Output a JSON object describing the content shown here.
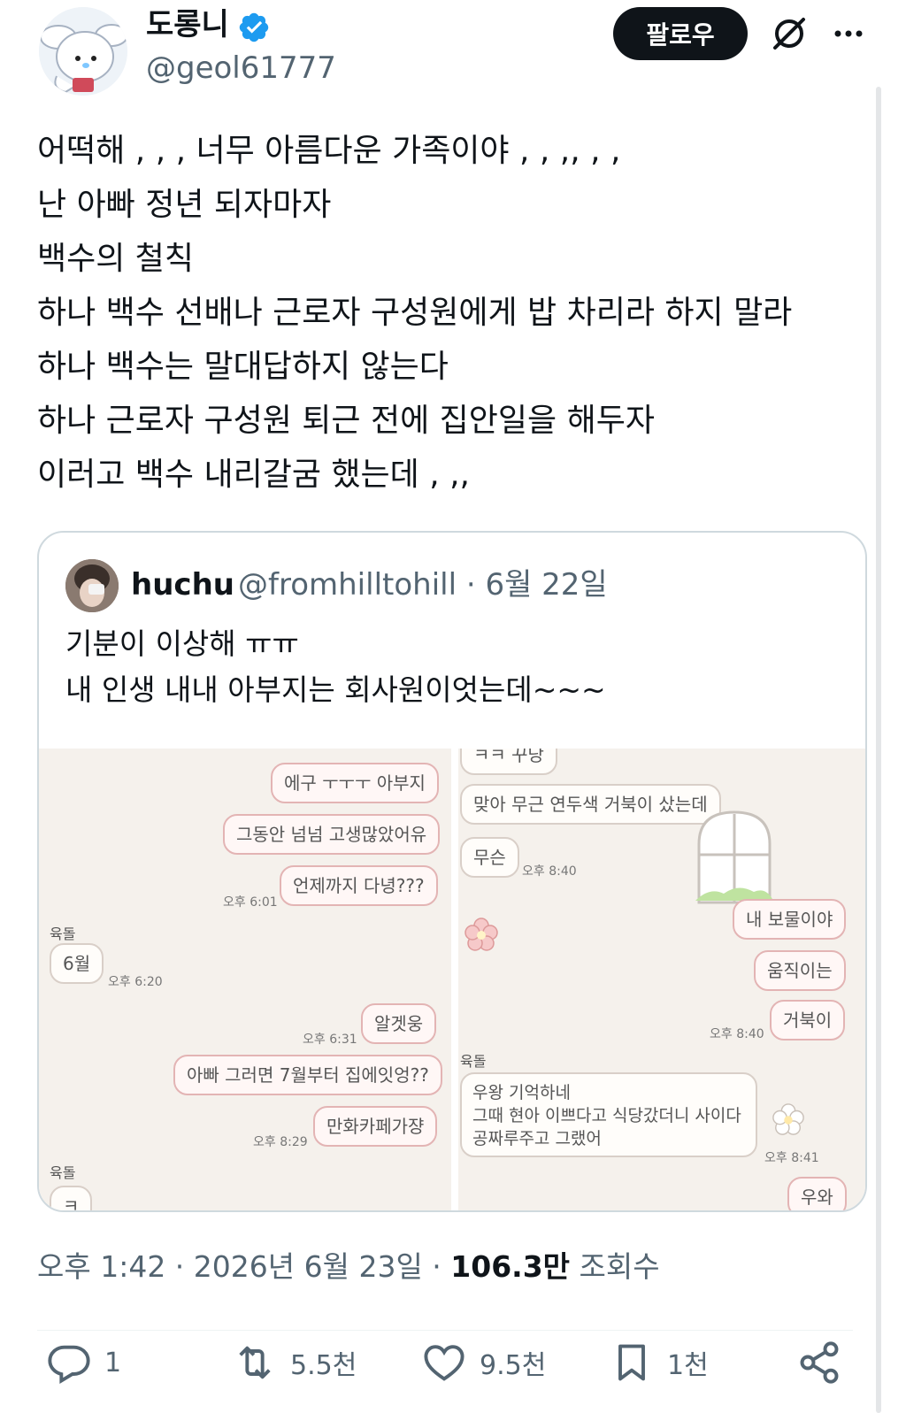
{
  "author": {
    "name": "도롱니",
    "handle": "@geol61777",
    "verified": true
  },
  "follow_label": "팔로우",
  "icons": {
    "verified": "verified-badge-icon",
    "grok": "grok-icon",
    "more": "more-icon",
    "reply": "reply-icon",
    "repost": "repost-icon",
    "like": "like-icon",
    "bookmark": "bookmark-icon",
    "share": "share-icon"
  },
  "tweet_lines": [
    "어떡해 , , , 너무 아름다운 가족이야 , , ,, , ,",
    "난 아빠 정년 되자마자",
    "백수의 철칙",
    "하나 백수 선배나 근로자 구성원에게 밥 차리라 하지 말라",
    "하나 백수는 말대답하지 않는다",
    "하나 근로자 구성원 퇴근 전에 집안일을 해두자",
    "이러고 백수 내리갈굼 했는데 , ,,"
  ],
  "quote": {
    "name": "huchu",
    "handle_date": "@fromhilltohill · 6월 22일",
    "lines": [
      "기분이 이상해 ㅠㅠ",
      "내 인생 내내 아부지는 회사원이엇는데~~~"
    ],
    "chat_left": {
      "bubbles": [
        "에구 ㅜㅜㅜ 아부지",
        "그동안 넘넘 고생많았어유",
        "언제까지 다녕???",
        "6월",
        "알겟웅",
        "아빠 그러면 7월부터 집에잇엉??",
        "만화카페가쟝",
        "ㅋ"
      ],
      "times": [
        "오후 6:01",
        "오후 6:20",
        "오후 6:31",
        "오후 8:29"
      ],
      "senders": [
        "육돌",
        "육돌"
      ]
    },
    "chat_right": {
      "bubbles": [
        "ㅋㅋ 꾸당",
        "맞아 무근 연두색 거북이 샀는데",
        "무슨",
        "내 보물이야",
        "움직이는",
        "거북이",
        "우왕 기억하네",
        "그때 현아 이쁘다고 식당갔더니 사이다",
        "공짜루주고 그랬어",
        "우와"
      ],
      "times": [
        "오후 8:40",
        "오후 8:40",
        "오후 8:41"
      ],
      "senders": [
        "육돌"
      ]
    }
  },
  "meta": {
    "time_date": "오후 1:42 · 2026년 6월 23일 · ",
    "views": "106.3만",
    "views_label": " 조회수"
  },
  "actions": {
    "replies": "1",
    "reposts": "5.5천",
    "likes": "9.5천",
    "bookmarks": "1천"
  },
  "colors": {
    "accent": "#1d9bf0",
    "text": "#0f1419",
    "muted": "#536471",
    "border": "#cfd9de"
  }
}
